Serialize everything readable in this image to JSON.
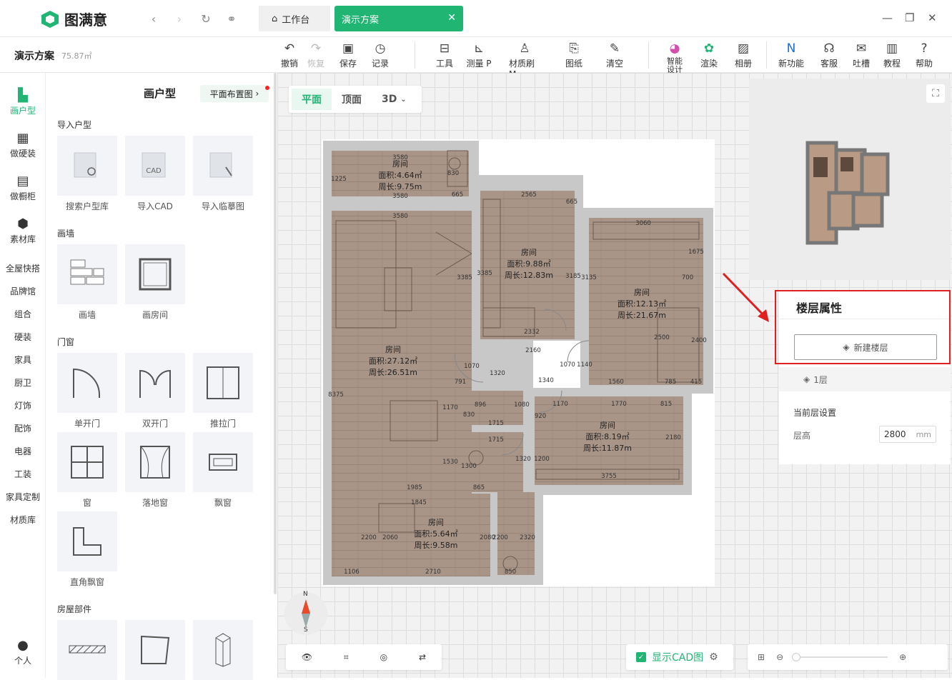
{
  "app": {
    "name": "图满意"
  },
  "tabs": {
    "work": "工作台",
    "demo": "演示方案"
  },
  "project": {
    "name": "演示方案",
    "area": "75.87㎡"
  },
  "toolbar": [
    {
      "label": "撤销",
      "icon": "undo-icon"
    },
    {
      "label": "恢复",
      "icon": "redo-icon"
    },
    {
      "label": "保存",
      "icon": "save-icon"
    },
    {
      "label": "记录",
      "icon": "history-icon"
    },
    {
      "label": "工具",
      "icon": "toolbox-icon"
    },
    {
      "label": "测量 P",
      "icon": "ruler-icon"
    },
    {
      "label": "材质刷 M",
      "icon": "brush-icon"
    },
    {
      "label": "图纸",
      "icon": "drawing-icon"
    },
    {
      "label": "清空",
      "icon": "clear-icon"
    },
    {
      "label": "智能设计",
      "icon": "ai-design-icon"
    },
    {
      "label": "渲染",
      "icon": "render-icon"
    },
    {
      "label": "相册",
      "icon": "album-icon"
    },
    {
      "label": "新功能",
      "icon": "new-feature-icon"
    },
    {
      "label": "客服",
      "icon": "headset-icon"
    },
    {
      "label": "吐槽",
      "icon": "feedback-icon"
    },
    {
      "label": "教程",
      "icon": "book-icon"
    },
    {
      "label": "帮助",
      "icon": "help-icon"
    }
  ],
  "leftnav": [
    "画户型",
    "做硬装",
    "做橱柜",
    "素材库"
  ],
  "leftnav_text": [
    "全屋快搭",
    "品牌馆",
    "组合",
    "硬装",
    "家具",
    "厨卫",
    "灯饰",
    "配饰",
    "电器",
    "工装",
    "家具定制",
    "材质库"
  ],
  "user": "个人",
  "catalog": {
    "title": "画户型",
    "plan_button": "平面布置图",
    "sections": {
      "import": "导入户型",
      "wall": "画墙",
      "door": "门窗",
      "parts": "房屋部件"
    },
    "import_items": [
      "搜索户型库",
      "导入CAD",
      "导入临摹图"
    ],
    "cad_badge": "CAD",
    "wall_items": [
      "画墙",
      "画房间"
    ],
    "door_items": [
      "单开门",
      "双开门",
      "推拉门",
      "窗",
      "落地窗",
      "飘窗",
      "直角飘窗"
    ]
  },
  "view": {
    "plan": "平面",
    "top": "顶面",
    "threed": "3D"
  },
  "rooms": [
    {
      "name": "房间",
      "area": "面积:4.64㎡",
      "perim": "周长:9.75m"
    },
    {
      "name": "房间",
      "area": "面积:9.88㎡",
      "perim": "周长:12.83m"
    },
    {
      "name": "房间",
      "area": "面积:12.13㎡",
      "perim": "周长:21.67m"
    },
    {
      "name": "房间",
      "area": "面积:27.12㎡",
      "perim": "周长:26.51m"
    },
    {
      "name": "房间",
      "area": "面积:8.19㎡",
      "perim": "周长:11.87m"
    },
    {
      "name": "房间",
      "area": "面积:5.64㎡",
      "perim": "周长:9.58m"
    }
  ],
  "dims": [
    "3580",
    "3580",
    "3580",
    "2565",
    "665",
    "3060",
    "1675",
    "700",
    "8375",
    "3385",
    "3185",
    "3135",
    "2500",
    "2400",
    "2332",
    "2160",
    "1070",
    "1320",
    "1340",
    "1070",
    "1140",
    "1560",
    "785",
    "415",
    "791",
    "1170",
    "1770",
    "815",
    "896",
    "1715",
    "1080",
    "920",
    "830",
    "1715",
    "1320",
    "1200",
    "1530",
    "1170",
    "1300",
    "865",
    "1985",
    "1845",
    "2180",
    "3755",
    "2200",
    "2060",
    "2080",
    "2200",
    "2320",
    "1106",
    "2710",
    "850",
    "1225",
    "830",
    "665",
    "3385"
  ],
  "compass": {
    "n": "N",
    "s": "S"
  },
  "props": {
    "title": "楼层属性",
    "new_floor": "新建楼层",
    "floor": "1层",
    "current": "当前层设置",
    "height_label": "层高",
    "height_value": "2800",
    "unit": "mm"
  },
  "bottom": {
    "show_cad": "显示CAD图"
  },
  "colors": {
    "accent": "#21b574",
    "highlight": "#e02020",
    "floor": "#a99588"
  }
}
